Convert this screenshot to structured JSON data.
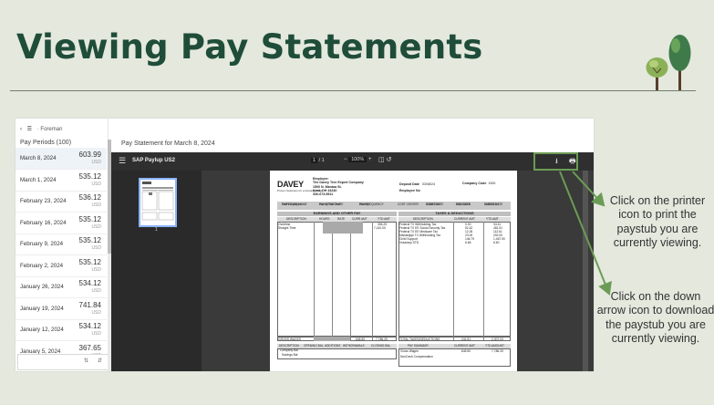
{
  "title": "Viewing Pay Statements",
  "left_panel": {
    "breadcrumb": "Foreman",
    "header": "Pay Periods (100)",
    "items": [
      {
        "date": "March 8, 2024",
        "amount": "603.99",
        "currency": "USD"
      },
      {
        "date": "March 1, 2024",
        "amount": "535.12",
        "currency": "USD"
      },
      {
        "date": "February 23, 2024",
        "amount": "536.12",
        "currency": "USD"
      },
      {
        "date": "February 16, 2024",
        "amount": "535.12",
        "currency": "USD"
      },
      {
        "date": "February 9, 2024",
        "amount": "535.12",
        "currency": "USD"
      },
      {
        "date": "February 2, 2024",
        "amount": "535.12",
        "currency": "USD"
      },
      {
        "date": "January 26, 2024",
        "amount": "534.12",
        "currency": "USD"
      },
      {
        "date": "January 19, 2024",
        "amount": "741.84",
        "currency": "USD"
      },
      {
        "date": "January 12, 2024",
        "amount": "534.12",
        "currency": "USD"
      },
      {
        "date": "January 5, 2024",
        "amount": "367.65",
        "currency": "USD"
      }
    ]
  },
  "statement_header": "Pay Statement for March 8, 2024",
  "viewer": {
    "file_name": "SAP Paylup US2",
    "page": "1",
    "page_total": "/ 1",
    "zoom": "100%",
    "thumb_label": "1"
  },
  "stub": {
    "logo": "DAVEY",
    "logo_sub": "Proven Solutions for a Growing World",
    "employer_label": "Employer:",
    "employer_lines": [
      "The Davey Tree Expert Company",
      "1500 N. Mantua St.",
      "Kent, OH 44240",
      "330-673-9511"
    ],
    "deposit_label": "Deposit Date",
    "deposit_date": "03/08/24",
    "employee_no_label": "Employee No",
    "company_code_label": "Company Code",
    "company_code": "1000",
    "info_headers": [
      "EMPLOYEE NAME",
      "PAY STRUCTURE",
      "PAY FREQUENCY",
      "COST CENTER",
      "START DATE",
      "END DATE",
      "CHECK DATE"
    ],
    "info_values": [
      "Tree Employee",
      "Hourly Full Time",
      "Weekly",
      "",
      "02/26/2024",
      "03/03/2024",
      "03/08/2024"
    ],
    "earnings_title": "EARNINGS AND OTHER PAY",
    "taxes_title": "TAXES & DEDUCTIONS",
    "earnings_cols": [
      "DESCRIPTION",
      "HOURS",
      "RATE",
      "CURR AMT",
      "YTD AMT"
    ],
    "earnings_rows": [
      {
        "desc": "Overtime",
        "curr": "",
        "ytd": "306.25"
      },
      {
        "desc": "Straight Time",
        "curr": "",
        "ytd": "7,410.00"
      }
    ],
    "tax_cols": [
      "DESCRIPTION",
      "CURRENT AMT",
      "YTD AMT"
    ],
    "tax_rows": [
      {
        "desc": "Federal   TX Withholding Tax",
        "curr": "0.00",
        "ytd": "34.41"
      },
      {
        "desc": "Federal   TX EE Social Security Tax",
        "curr": "52.42",
        "ytd": "481.51"
      },
      {
        "desc": "Federal   TX EE Medicare Tax",
        "curr": "12.26",
        "ytd": "112.61"
      },
      {
        "desc": "Mississippi  TX Withholding Tax",
        "curr": "23.00",
        "ytd": "202.00"
      },
      {
        "desc": "Child Support",
        "curr": "146.79",
        "ytd": "1,467.90"
      },
      {
        "desc": "Voluntary STD",
        "curr": "6.66",
        "ytd": "6.60"
      }
    ],
    "gross_label": "GROSS WAGES",
    "gross_curr": "845.50",
    "gross_ytd": "7,786.25",
    "total_taxes_label": "TOTAL TAXES/DEDUCTIONS",
    "total_taxes_curr": "241.51",
    "total_taxes_ytd": "2,307.03",
    "bal_cols": [
      "DESCRIPTION",
      "OPENING BAL",
      "ADDITIONS",
      "WITHDRAWALS",
      "CLOSING BAL"
    ],
    "bal_rows": [
      "Company Bal",
      "Savings Bal"
    ],
    "summary_cols": [
      "PAY SUMMARY",
      "CURRENT AMT",
      "YTD AMOUNT"
    ],
    "summary_rows": [
      {
        "desc": "Gross Wages",
        "curr": "845.50",
        "ytd": "7,786.25"
      },
      {
        "desc": "NonCash Compensation",
        "curr": "",
        "ytd": ""
      }
    ]
  },
  "annotations": {
    "printer": "Click on the printer icon to print the paystub you are currently viewing.",
    "download": "Click on the down arrow icon to download the paystub you are currently viewing."
  },
  "colors": {
    "title": "#1f4d3a",
    "background": "#e4e8dd",
    "highlight": "#6b9c55"
  }
}
